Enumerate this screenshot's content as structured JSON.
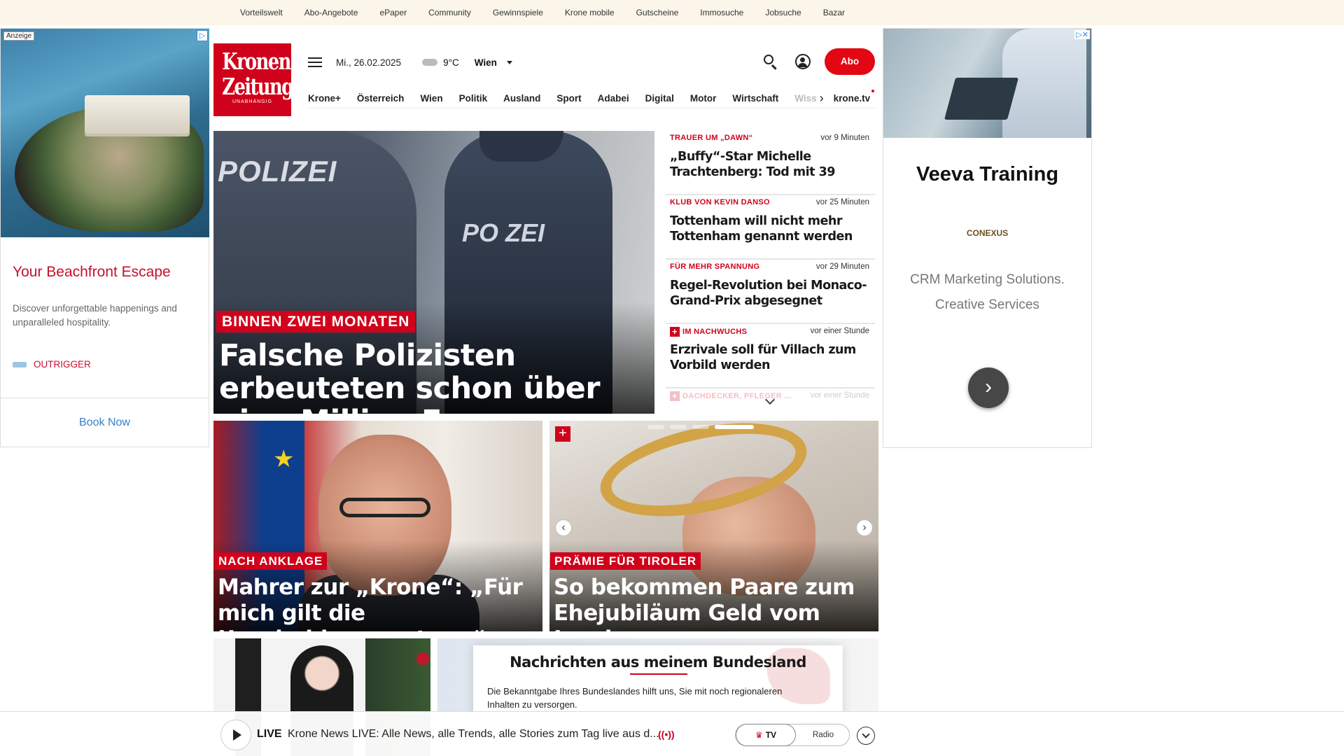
{
  "topbar": {
    "links": [
      "Vorteilswelt",
      "Abo-Angebote",
      "ePaper",
      "Community",
      "Gewinnspiele",
      "Krone mobile",
      "Gutscheine",
      "Immosuche",
      "Jobsuche",
      "Bazar"
    ]
  },
  "ad_left": {
    "tag": "Anzeige",
    "corner": "▷",
    "title": "Your Beachfront Escape",
    "description": "Discover unforgettable happenings and unparalleled hospitality.",
    "brand": "OUTRIGGER",
    "cta": "Book Now"
  },
  "ad_right": {
    "corner": "▷✕",
    "title": "Veeva Training",
    "brand": "CONEXUS",
    "description_line1": "CRM Marketing Solutions.",
    "description_line2": "Creative Services",
    "next": "›"
  },
  "logo": {
    "line1": "Kronen",
    "line2": "Zeitung",
    "tagline": "UNABHÄNGIG"
  },
  "header": {
    "date": "Mi., 26.02.2025",
    "temperature": "9°C",
    "city": "Wien",
    "abo_label": "Abo"
  },
  "nav": {
    "items": [
      "Krone+",
      "Österreich",
      "Wien",
      "Politik",
      "Ausland",
      "Sport",
      "Adabei",
      "Digital",
      "Motor",
      "Wirtschaft"
    ],
    "truncated": "Wiss",
    "tv": "krone.tv"
  },
  "hero": {
    "image_text_1": "POLIZEI",
    "image_text_2": "PO ZEI",
    "kicker": "BINNEN ZWEI MONATEN",
    "headline": "Falsche Polizisten erbeuteten schon über eine Million Euro"
  },
  "news": [
    {
      "kicker": "TRAUER UM „DAWN“",
      "time": "vor 9 Minuten",
      "title": "„Buffy“-Star Michelle Trachtenberg: Tod mit 39",
      "plus": false
    },
    {
      "kicker": "KLUB VON KEVIN DANSO",
      "time": "vor 25 Minuten",
      "title": "Tottenham will nicht mehr Tottenham genannt werden",
      "plus": false
    },
    {
      "kicker": "FÜR MEHR SPANNUNG",
      "time": "vor 29 Minuten",
      "title": "Regel-Revolution bei Monaco-Grand-Prix abgesegnet",
      "plus": false
    },
    {
      "kicker": "IM NACHWUCHS",
      "time": "vor einer Stunde",
      "title": "Erzrivale soll für Villach zum Vorbild werden",
      "plus": true
    },
    {
      "kicker": "DACHDECKER, PFLEGER ...",
      "time": "vor einer Stunde",
      "title": "",
      "plus": true
    }
  ],
  "teaser1": {
    "kicker": "NACH ANKLAGE",
    "headline": "Mahrer zur „Krone“: „Für mich gilt die Unschuldsvermutung“"
  },
  "teaser2": {
    "kicker": "PRÄMIE FÜR TIROLER",
    "headline": "So bekommen Paare zum Ehejubiläum Geld vom Land",
    "prev": "‹",
    "next": "›",
    "plus": "+"
  },
  "bundesland": {
    "title": "Nachrichten aus meinem Bundesland",
    "body": "Die Bekanntgabe Ihres Bundeslandes hilft uns, Sie mit noch regionaleren Inhalten zu versorgen."
  },
  "livebar": {
    "label": "LIVE",
    "text": "Krone News LIVE: Alle News, alle Trends, alle Stories zum Tag live aus d...",
    "radio_icon": "((•))",
    "tv_label": "TV",
    "radio_label": "Radio"
  },
  "colors": {
    "brand_red": "#d0021b",
    "topbar_bg": "#fbf6e9"
  }
}
